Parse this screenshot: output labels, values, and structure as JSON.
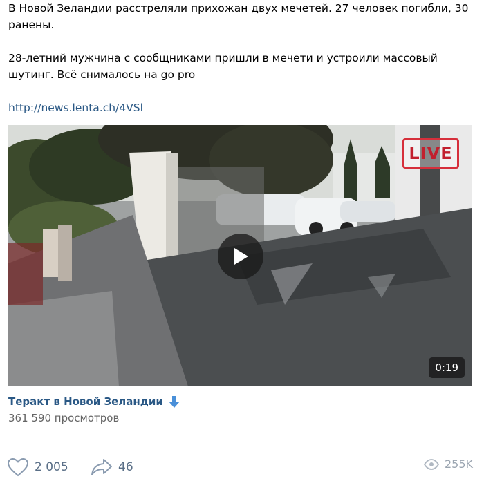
{
  "post": {
    "line1": "В Новой Зеландии расстреляли прихожан двух мечетей. 27 человек погибли, 30 ранены.",
    "line2": "28-летний мужчина с сообщниками пришли в мечети и устроили массовый шутинг. Всё снималось на go pro",
    "link": "http://news.lenta.ch/4VSl"
  },
  "video": {
    "live_label": "LIVE",
    "duration": "0:19",
    "title": "Теракт в Новой Зеландии",
    "views": "361 590 просмотров"
  },
  "footer": {
    "likes": "2 005",
    "shares": "46",
    "views": "255K"
  },
  "icons": {
    "heart": "heart-icon",
    "share": "share-icon",
    "eye": "eye-icon",
    "down_arrow": "down-arrow-emoji-icon",
    "play": "play-icon"
  },
  "colors": {
    "link": "#2a5885",
    "muted": "#656565",
    "live": "#d62f3b",
    "arrow_emoji": "#4a90d9"
  }
}
